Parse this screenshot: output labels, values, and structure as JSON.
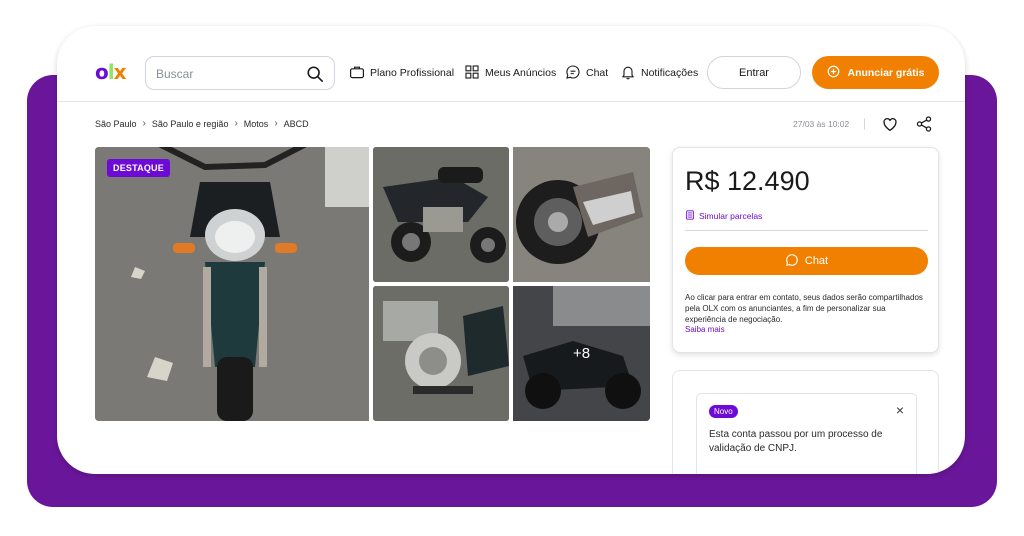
{
  "colors": {
    "brand_purple": "#6e0ad6",
    "brand_orange": "#f28000",
    "brand_green": "#8ce563",
    "frame_purple": "#6a169a"
  },
  "logo": {
    "o": "o",
    "l": "l",
    "x": "x"
  },
  "search": {
    "placeholder": "Buscar",
    "icon": "search-icon"
  },
  "nav": {
    "plano": {
      "label": "Plano Profissional",
      "icon": "briefcase-icon"
    },
    "anuncios": {
      "label": "Meus Anúncios",
      "icon": "grid-icon"
    },
    "chat": {
      "label": "Chat",
      "icon": "chat-icon"
    },
    "notificacoes": {
      "label": "Notificações",
      "icon": "bell-icon"
    },
    "entrar": "Entrar",
    "anunciar": "Anunciar grátis"
  },
  "breadcrumb": [
    "São Paulo",
    "São Paulo e região",
    "Motos",
    "ABCD"
  ],
  "listing": {
    "date": "27/03 às 10:02"
  },
  "gallery": {
    "badge": "DESTAQUE",
    "more_count": "+8"
  },
  "price_card": {
    "price": "R$ 12.490",
    "simular": "Simular parcelas",
    "chat_button": "Chat",
    "disclaimer": "Ao clicar para entrar em contato, seus dados serão compartilhados pela OLX com os anunciantes, a fim de personalizar sua experiência de negociação.",
    "saiba_mais": "Saiba mais"
  },
  "notice": {
    "badge": "Novo",
    "text": "Esta conta passou por um processo de validação de CNPJ.",
    "close": "×"
  }
}
